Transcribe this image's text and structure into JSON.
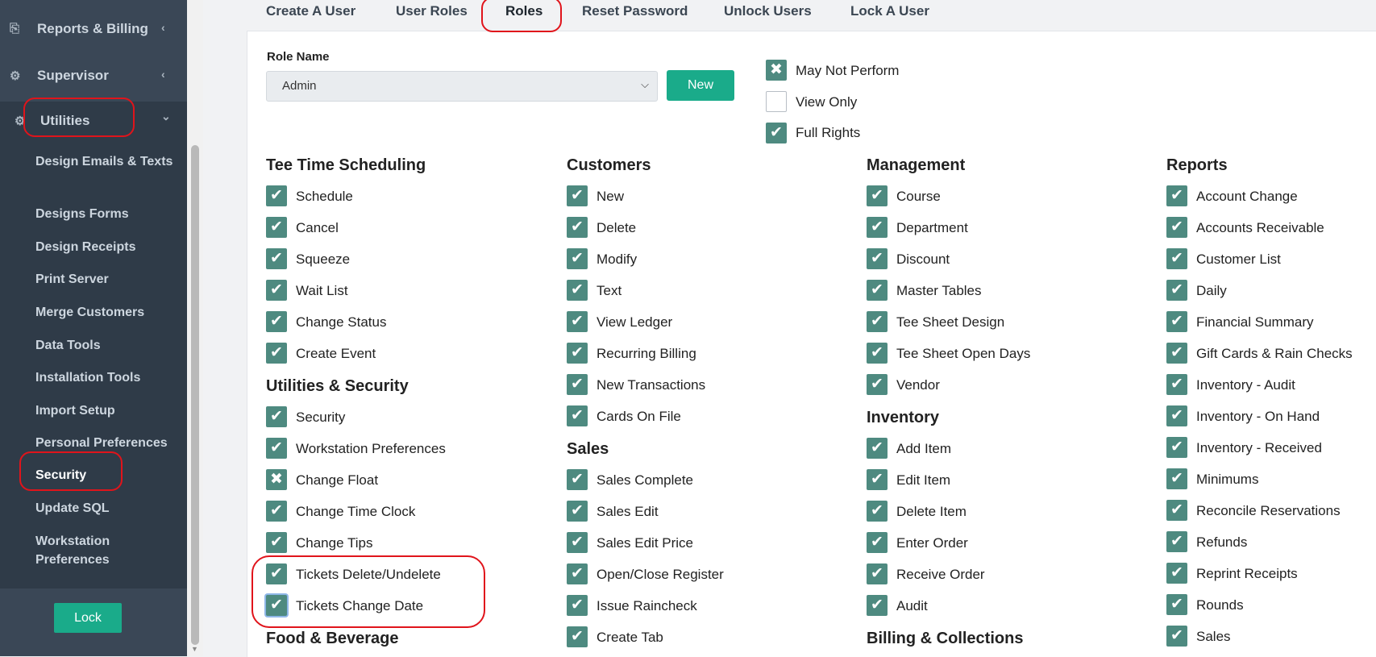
{
  "sidebar": {
    "top_items": [
      {
        "label": "Reports & Billing",
        "icon": "clipboard-icon",
        "chevron": "‹"
      },
      {
        "label": "Supervisor",
        "icon": "gear-icon",
        "chevron": "‹"
      },
      {
        "label": "Utilities",
        "icon": "gear-icon",
        "chevron": "⌄"
      }
    ],
    "sub_items": [
      {
        "label": "Design Emails & Texts"
      },
      {
        "label": "Designs Forms"
      },
      {
        "label": "Design Receipts"
      },
      {
        "label": "Print Server"
      },
      {
        "label": "Merge Customers"
      },
      {
        "label": "Data Tools"
      },
      {
        "label": "Installation Tools"
      },
      {
        "label": "Import Setup"
      },
      {
        "label": "Personal Preferences"
      },
      {
        "label": "Security",
        "active": true
      },
      {
        "label": "Update SQL"
      },
      {
        "label": "Workstation Preferences"
      }
    ],
    "lock_label": "Lock"
  },
  "tabs": [
    {
      "label": "Create A User"
    },
    {
      "label": "User Roles"
    },
    {
      "label": "Roles",
      "active": true
    },
    {
      "label": "Reset Password"
    },
    {
      "label": "Unlock Users"
    },
    {
      "label": "Lock A User"
    }
  ],
  "role": {
    "label": "Role Name",
    "selected": "Admin",
    "new_label": "New"
  },
  "legend": [
    {
      "label": "May Not Perform",
      "state": "x"
    },
    {
      "label": "View Only",
      "state": "empty"
    },
    {
      "label": "Full Rights",
      "state": "check"
    }
  ],
  "columns": [
    {
      "sections": [
        {
          "title": "Tee Time Scheduling",
          "items": [
            {
              "label": "Schedule",
              "state": "check"
            },
            {
              "label": "Cancel",
              "state": "check"
            },
            {
              "label": "Squeeze",
              "state": "check"
            },
            {
              "label": "Wait List",
              "state": "check"
            },
            {
              "label": "Change Status",
              "state": "check"
            },
            {
              "label": "Create Event",
              "state": "check"
            }
          ]
        },
        {
          "title": "Utilities & Security",
          "items": [
            {
              "label": "Security",
              "state": "check"
            },
            {
              "label": "Workstation Preferences",
              "state": "check"
            },
            {
              "label": "Change Float",
              "state": "x"
            },
            {
              "label": "Change Time Clock",
              "state": "check"
            },
            {
              "label": "Change Tips",
              "state": "check"
            },
            {
              "label": "Tickets Delete/Undelete",
              "state": "check"
            },
            {
              "label": "Tickets Change Date",
              "state": "check",
              "focus": true
            }
          ]
        },
        {
          "title": "Food & Beverage",
          "items": []
        }
      ]
    },
    {
      "sections": [
        {
          "title": "Customers",
          "items": [
            {
              "label": "New",
              "state": "check"
            },
            {
              "label": "Delete",
              "state": "check"
            },
            {
              "label": "Modify",
              "state": "check"
            },
            {
              "label": "Text",
              "state": "check"
            },
            {
              "label": "View Ledger",
              "state": "check"
            },
            {
              "label": "Recurring Billing",
              "state": "check"
            },
            {
              "label": "New Transactions",
              "state": "check"
            },
            {
              "label": "Cards On File",
              "state": "check"
            }
          ]
        },
        {
          "title": "Sales",
          "items": [
            {
              "label": "Sales Complete",
              "state": "check"
            },
            {
              "label": "Sales Edit",
              "state": "check"
            },
            {
              "label": "Sales Edit Price",
              "state": "check"
            },
            {
              "label": "Open/Close Register",
              "state": "check"
            },
            {
              "label": "Issue Raincheck",
              "state": "check"
            },
            {
              "label": "Create Tab",
              "state": "check"
            }
          ]
        }
      ]
    },
    {
      "sections": [
        {
          "title": "Management",
          "items": [
            {
              "label": "Course",
              "state": "check"
            },
            {
              "label": "Department",
              "state": "check"
            },
            {
              "label": "Discount",
              "state": "check"
            },
            {
              "label": "Master Tables",
              "state": "check"
            },
            {
              "label": "Tee Sheet Design",
              "state": "check"
            },
            {
              "label": "Tee Sheet Open Days",
              "state": "check"
            },
            {
              "label": "Vendor",
              "state": "check"
            }
          ]
        },
        {
          "title": "Inventory",
          "items": [
            {
              "label": "Add Item",
              "state": "check"
            },
            {
              "label": "Edit Item",
              "state": "check"
            },
            {
              "label": "Delete Item",
              "state": "check"
            },
            {
              "label": "Enter Order",
              "state": "check"
            },
            {
              "label": "Receive Order",
              "state": "check"
            },
            {
              "label": "Audit",
              "state": "check"
            }
          ]
        },
        {
          "title": "Billing & Collections",
          "items": []
        }
      ]
    },
    {
      "sections": [
        {
          "title": "Reports",
          "items": [
            {
              "label": "Account Change",
              "state": "check"
            },
            {
              "label": "Accounts Receivable",
              "state": "check"
            },
            {
              "label": "Customer List",
              "state": "check"
            },
            {
              "label": "Daily",
              "state": "check"
            },
            {
              "label": "Financial Summary",
              "state": "check"
            },
            {
              "label": "Gift Cards & Rain Checks",
              "state": "check"
            },
            {
              "label": "Inventory - Audit",
              "state": "check"
            },
            {
              "label": "Inventory - On Hand",
              "state": "check"
            },
            {
              "label": "Inventory - Received",
              "state": "check"
            },
            {
              "label": "Minimums",
              "state": "check"
            },
            {
              "label": "Reconcile Reservations",
              "state": "check"
            },
            {
              "label": "Refunds",
              "state": "check"
            },
            {
              "label": "Reprint Receipts",
              "state": "check"
            },
            {
              "label": "Rounds",
              "state": "check"
            },
            {
              "label": "Sales",
              "state": "check"
            }
          ]
        }
      ]
    }
  ],
  "colors": {
    "accent": "#1aab8a",
    "checkbox": "#4e8a80",
    "sidebar": "#3a4756",
    "highlight": "#e0141b"
  }
}
